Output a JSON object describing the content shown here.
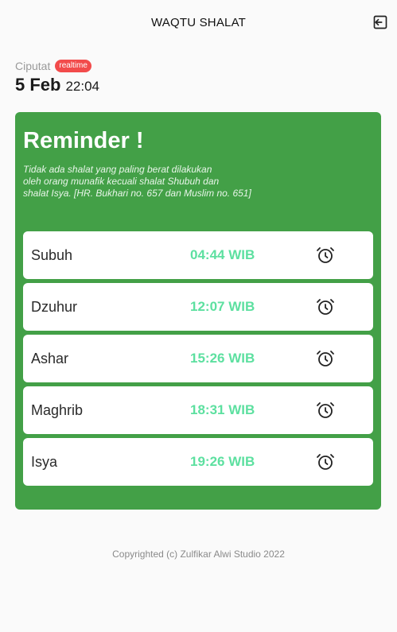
{
  "header": {
    "title": "WAQTU SHALAT",
    "logout_icon": "logout-icon"
  },
  "info": {
    "location": "Ciputat",
    "badge": "realtime",
    "date": "5 Feb",
    "time": "22:04"
  },
  "reminder": {
    "title": "Reminder !",
    "hadith_lines": [
      "Tidak ada shalat yang paling berat dilakukan",
      "oleh orang munafik kecuali shalat Shubuh dan",
      "shalat Isya. [HR. Bukhari no. 657 dan Muslim no. 651]"
    ]
  },
  "prayers": [
    {
      "name": "Subuh",
      "time": "04:44 WIB",
      "icon": "alarm-clock-icon"
    },
    {
      "name": "Dzuhur",
      "time": "12:07 WIB",
      "icon": "alarm-clock-icon"
    },
    {
      "name": "Ashar",
      "time": "15:26 WIB",
      "icon": "alarm-clock-icon"
    },
    {
      "name": "Maghrib",
      "time": "18:31 WIB",
      "icon": "alarm-clock-icon"
    },
    {
      "name": "Isya",
      "time": "19:26 WIB",
      "icon": "alarm-clock-icon"
    }
  ],
  "colors": {
    "card": "#43a047",
    "time_text": "#5de0a0",
    "badge": "#f24b4b"
  },
  "footer": {
    "text": "Copyrighted (c) Zulfikar Alwi Studio 2022"
  }
}
